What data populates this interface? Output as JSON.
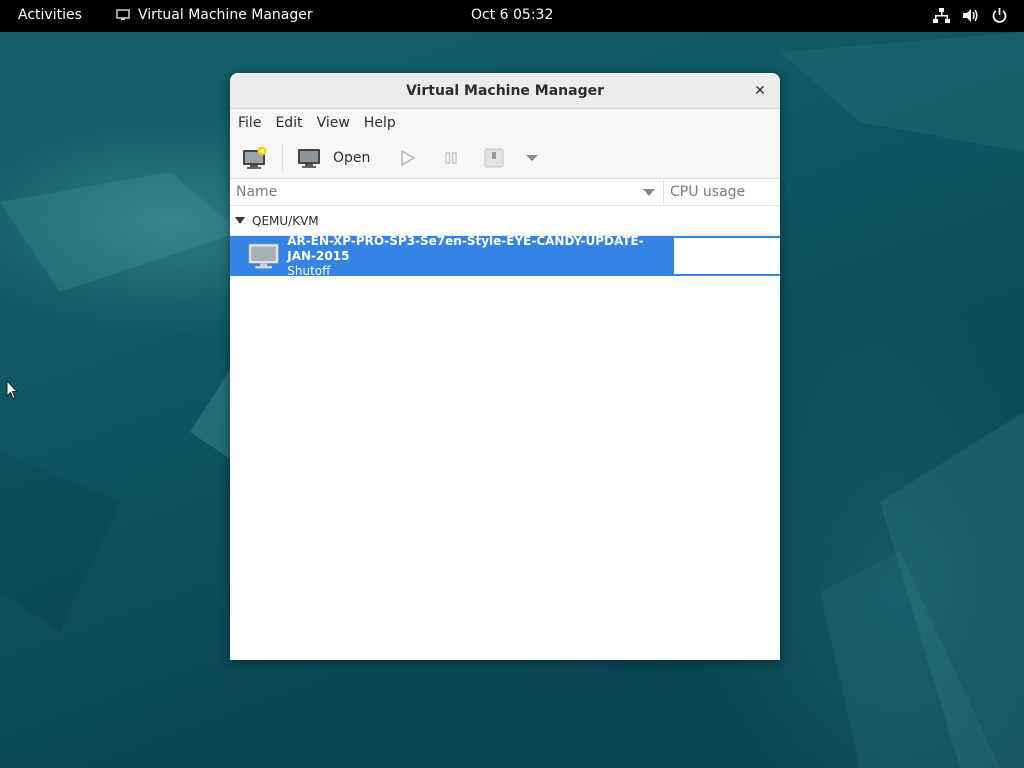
{
  "topbar": {
    "activities": "Activities",
    "app_name": "Virtual Machine Manager",
    "clock": "Oct 6  05:32",
    "tray_icons": [
      "network-icon",
      "volume-icon",
      "power-icon"
    ]
  },
  "window": {
    "title": "Virtual Machine Manager",
    "close_glyph": "✕",
    "menu": [
      "File",
      "Edit",
      "View",
      "Help"
    ],
    "toolbar": {
      "new_vm_icon": "new-vm-icon",
      "open_label": "Open",
      "run_icon": "play-icon",
      "pause_icon": "pause-icon",
      "shutdown_icon": "shutdown-icon",
      "shutdown_menu_icon": "chevron-down-icon"
    },
    "columns": {
      "name": "Name",
      "cpu": "CPU usage"
    },
    "group": {
      "label": "QEMU/KVM"
    },
    "vms": [
      {
        "name": "AR-EN-XP-PRO-SP3-Se7en-Style-EYE-CANDY-UPDATE-JAN-2015",
        "state": "Shutoff",
        "selected": true
      }
    ]
  },
  "colors": {
    "selection": "#3584e4",
    "topbar": "#000000",
    "desktop": "#0f5662"
  }
}
